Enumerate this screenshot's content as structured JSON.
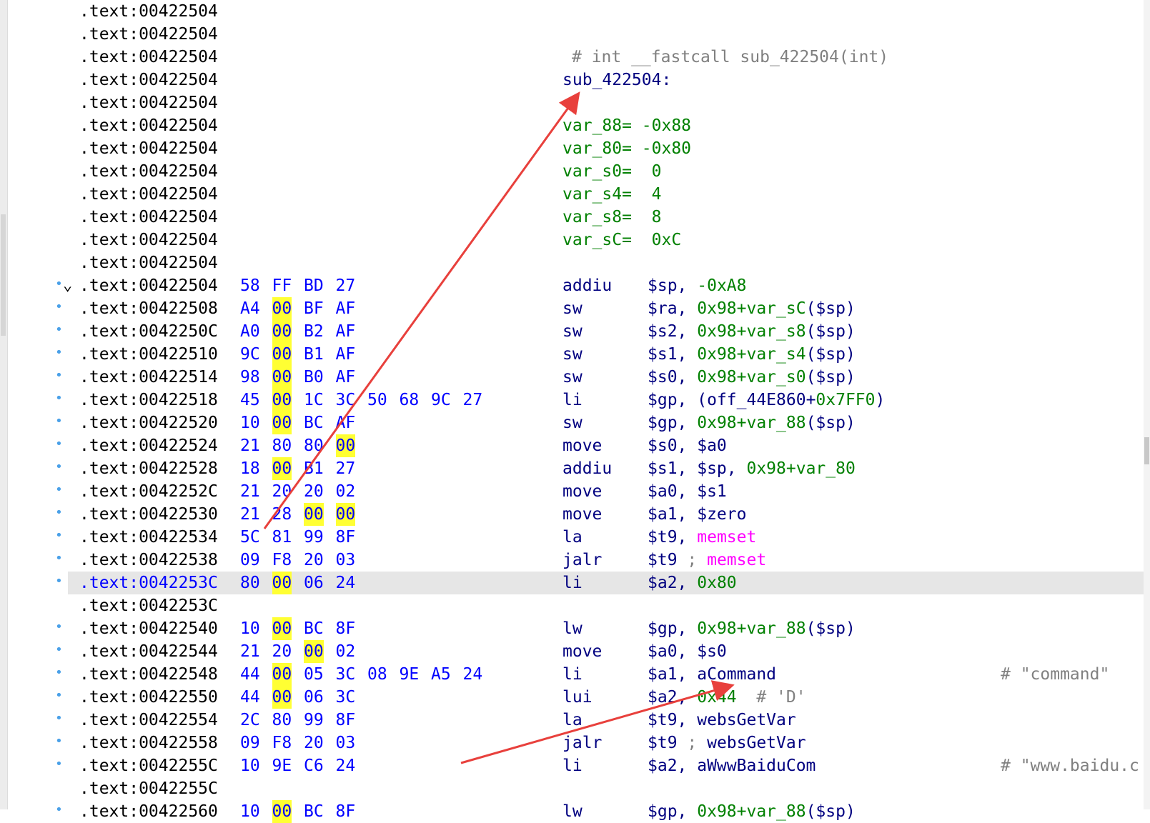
{
  "listing": {
    "rows": [
      {
        "addr": ".text:00422504"
      },
      {
        "addr": ".text:00422504"
      },
      {
        "addr": ".text:00422504",
        "header_comment": "# int __fastcall sub_422504(int)"
      },
      {
        "addr": ".text:00422504",
        "label": "sub_422504:"
      },
      {
        "addr": ".text:00422504"
      },
      {
        "addr": ".text:00422504",
        "stackvar": "var_88= -0x88"
      },
      {
        "addr": ".text:00422504",
        "stackvar": "var_80= -0x80"
      },
      {
        "addr": ".text:00422504",
        "stackvar": "var_s0=  0"
      },
      {
        "addr": ".text:00422504",
        "stackvar": "var_s4=  4"
      },
      {
        "addr": ".text:00422504",
        "stackvar": "var_s8=  8"
      },
      {
        "addr": ".text:00422504",
        "stackvar": "var_sC=  0xC"
      },
      {
        "addr": ".text:00422504"
      },
      {
        "addr": ".text:00422504",
        "collapse": true,
        "dot": true,
        "bytes": [
          {
            "v": "58"
          },
          {
            "v": "FF"
          },
          {
            "v": "BD"
          },
          {
            "v": "27"
          }
        ],
        "mnem": "addiu",
        "ops": [
          {
            "t": "$sp, "
          },
          {
            "t": "-0xA8",
            "c": "g"
          }
        ]
      },
      {
        "addr": ".text:00422508",
        "dot": true,
        "bytes": [
          {
            "v": "A4"
          },
          {
            "v": "00",
            "h": true
          },
          {
            "v": "BF"
          },
          {
            "v": "AF"
          }
        ],
        "mnem": "sw",
        "ops": [
          {
            "t": "$ra, "
          },
          {
            "t": "0x98+var_sC",
            "c": "g"
          },
          {
            "t": "($sp)"
          }
        ]
      },
      {
        "addr": ".text:0042250C",
        "dot": true,
        "bytes": [
          {
            "v": "A0"
          },
          {
            "v": "00",
            "h": true
          },
          {
            "v": "B2"
          },
          {
            "v": "AF"
          }
        ],
        "mnem": "sw",
        "ops": [
          {
            "t": "$s2, "
          },
          {
            "t": "0x98+var_s8",
            "c": "g"
          },
          {
            "t": "($sp)"
          }
        ]
      },
      {
        "addr": ".text:00422510",
        "dot": true,
        "bytes": [
          {
            "v": "9C"
          },
          {
            "v": "00",
            "h": true
          },
          {
            "v": "B1"
          },
          {
            "v": "AF"
          }
        ],
        "mnem": "sw",
        "ops": [
          {
            "t": "$s1, "
          },
          {
            "t": "0x98+var_s4",
            "c": "g"
          },
          {
            "t": "($sp)"
          }
        ]
      },
      {
        "addr": ".text:00422514",
        "dot": true,
        "bytes": [
          {
            "v": "98"
          },
          {
            "v": "00",
            "h": true
          },
          {
            "v": "B0"
          },
          {
            "v": "AF"
          }
        ],
        "mnem": "sw",
        "ops": [
          {
            "t": "$s0, "
          },
          {
            "t": "0x98+var_s0",
            "c": "g"
          },
          {
            "t": "($sp)"
          }
        ]
      },
      {
        "addr": ".text:00422518",
        "dot": true,
        "bytes": [
          {
            "v": "45"
          },
          {
            "v": "00",
            "h": true
          },
          {
            "v": "1C"
          },
          {
            "v": "3C"
          },
          {
            "v": "50"
          },
          {
            "v": "68"
          },
          {
            "v": "9C"
          },
          {
            "v": "27"
          }
        ],
        "mnem": "li",
        "ops": [
          {
            "t": "$gp, "
          },
          {
            "t": "(off_44E860+"
          },
          {
            "t": "0x7FF0",
            "c": "g"
          },
          {
            "t": ")"
          }
        ]
      },
      {
        "addr": ".text:00422520",
        "dot": true,
        "bytes": [
          {
            "v": "10"
          },
          {
            "v": "00",
            "h": true
          },
          {
            "v": "BC"
          },
          {
            "v": "AF"
          }
        ],
        "mnem": "sw",
        "ops": [
          {
            "t": "$gp, "
          },
          {
            "t": "0x98+var_88",
            "c": "g"
          },
          {
            "t": "($sp)"
          }
        ]
      },
      {
        "addr": ".text:00422524",
        "dot": true,
        "bytes": [
          {
            "v": "21"
          },
          {
            "v": "80"
          },
          {
            "v": "80"
          },
          {
            "v": "00",
            "h": true
          }
        ],
        "mnem": "move",
        "ops": [
          {
            "t": "$s0, $a0"
          }
        ]
      },
      {
        "addr": ".text:00422528",
        "dot": true,
        "bytes": [
          {
            "v": "18"
          },
          {
            "v": "00",
            "h": true
          },
          {
            "v": "B1"
          },
          {
            "v": "27"
          }
        ],
        "mnem": "addiu",
        "ops": [
          {
            "t": "$s1, $sp, "
          },
          {
            "t": "0x98+var_80",
            "c": "g"
          }
        ]
      },
      {
        "addr": ".text:0042252C",
        "dot": true,
        "bytes": [
          {
            "v": "21"
          },
          {
            "v": "20"
          },
          {
            "v": "20"
          },
          {
            "v": "02"
          }
        ],
        "mnem": "move",
        "ops": [
          {
            "t": "$a0, $s1"
          }
        ]
      },
      {
        "addr": ".text:00422530",
        "dot": true,
        "bytes": [
          {
            "v": "21"
          },
          {
            "v": "28"
          },
          {
            "v": "00",
            "h": true
          },
          {
            "v": "00",
            "h": true
          }
        ],
        "mnem": "move",
        "ops": [
          {
            "t": "$a1, $zero"
          }
        ]
      },
      {
        "addr": ".text:00422534",
        "dot": true,
        "bytes": [
          {
            "v": "5C"
          },
          {
            "v": "81"
          },
          {
            "v": "99"
          },
          {
            "v": "8F"
          }
        ],
        "mnem": "la",
        "ops": [
          {
            "t": "$t9, "
          },
          {
            "t": "memset",
            "c": "m"
          }
        ]
      },
      {
        "addr": ".text:00422538",
        "dot": true,
        "bytes": [
          {
            "v": "09"
          },
          {
            "v": "F8"
          },
          {
            "v": "20"
          },
          {
            "v": "03"
          }
        ],
        "mnem": "jalr",
        "ops": [
          {
            "t": "$t9 "
          },
          {
            "t": "; ",
            "c": "c"
          },
          {
            "t": "memset",
            "c": "m"
          }
        ]
      },
      {
        "addr": ".text:0042253C",
        "dot": true,
        "highlight": true,
        "bytes": [
          {
            "v": "80"
          },
          {
            "v": "00",
            "h": true
          },
          {
            "v": "06"
          },
          {
            "v": "24"
          }
        ],
        "mnem": "li",
        "ops": [
          {
            "t": "$a2, "
          },
          {
            "t": "0x80",
            "c": "g"
          }
        ]
      },
      {
        "addr": ".text:0042253C"
      },
      {
        "addr": ".text:00422540",
        "dot": true,
        "bytes": [
          {
            "v": "10"
          },
          {
            "v": "00",
            "h": true
          },
          {
            "v": "BC"
          },
          {
            "v": "8F"
          }
        ],
        "mnem": "lw",
        "ops": [
          {
            "t": "$gp, "
          },
          {
            "t": "0x98+var_88",
            "c": "g"
          },
          {
            "t": "($sp)"
          }
        ]
      },
      {
        "addr": ".text:00422544",
        "dot": true,
        "bytes": [
          {
            "v": "21"
          },
          {
            "v": "20"
          },
          {
            "v": "00",
            "h": true
          },
          {
            "v": "02"
          }
        ],
        "mnem": "move",
        "ops": [
          {
            "t": "$a0, $s0"
          }
        ]
      },
      {
        "addr": ".text:00422548",
        "dot": true,
        "bytes": [
          {
            "v": "44"
          },
          {
            "v": "00",
            "h": true
          },
          {
            "v": "05"
          },
          {
            "v": "3C"
          },
          {
            "v": "08"
          },
          {
            "v": "9E"
          },
          {
            "v": "A5"
          },
          {
            "v": "24"
          }
        ],
        "mnem": "li",
        "ops": [
          {
            "t": "$a1, aCommand"
          }
        ],
        "comment": "# \"command\""
      },
      {
        "addr": ".text:00422550",
        "dot": true,
        "bytes": [
          {
            "v": "44"
          },
          {
            "v": "00",
            "h": true
          },
          {
            "v": "06"
          },
          {
            "v": "3C"
          }
        ],
        "mnem": "lui",
        "ops": [
          {
            "t": "$a2, "
          },
          {
            "t": "0x44",
            "c": "g"
          },
          {
            "t": "  # 'D'",
            "c": "c"
          }
        ]
      },
      {
        "addr": ".text:00422554",
        "dot": true,
        "bytes": [
          {
            "v": "2C"
          },
          {
            "v": "80"
          },
          {
            "v": "99"
          },
          {
            "v": "8F"
          }
        ],
        "mnem": "la",
        "ops": [
          {
            "t": "$t9, websGetVar"
          }
        ]
      },
      {
        "addr": ".text:00422558",
        "dot": true,
        "bytes": [
          {
            "v": "09"
          },
          {
            "v": "F8"
          },
          {
            "v": "20"
          },
          {
            "v": "03"
          }
        ],
        "mnem": "jalr",
        "ops": [
          {
            "t": "$t9 "
          },
          {
            "t": "; ",
            "c": "c"
          },
          {
            "t": "websGetVar"
          }
        ]
      },
      {
        "addr": ".text:0042255C",
        "dot": true,
        "bytes": [
          {
            "v": "10"
          },
          {
            "v": "9E"
          },
          {
            "v": "C6"
          },
          {
            "v": "24"
          }
        ],
        "mnem": "li",
        "ops": [
          {
            "t": "$a2, aWwwBaiduCom"
          }
        ],
        "comment": "# \"www.baidu.c"
      },
      {
        "addr": ".text:0042255C"
      },
      {
        "addr": ".text:00422560",
        "dot": true,
        "bytes": [
          {
            "v": "10"
          },
          {
            "v": "00",
            "h": true
          },
          {
            "v": "BC"
          },
          {
            "v": "8F"
          }
        ],
        "mnem": "lw",
        "ops": [
          {
            "t": "$gp, "
          },
          {
            "t": "0x98+var_88",
            "c": "g"
          },
          {
            "t": "($sp)"
          }
        ]
      }
    ]
  },
  "colors": {
    "address": "#000000",
    "bytes": "#0000ff",
    "highlight_byte": "#ffff33",
    "mnemonic": "#000080",
    "number": "#008000",
    "import": "#ff00ff",
    "comment": "#808080",
    "arrow": "#e8403c"
  }
}
